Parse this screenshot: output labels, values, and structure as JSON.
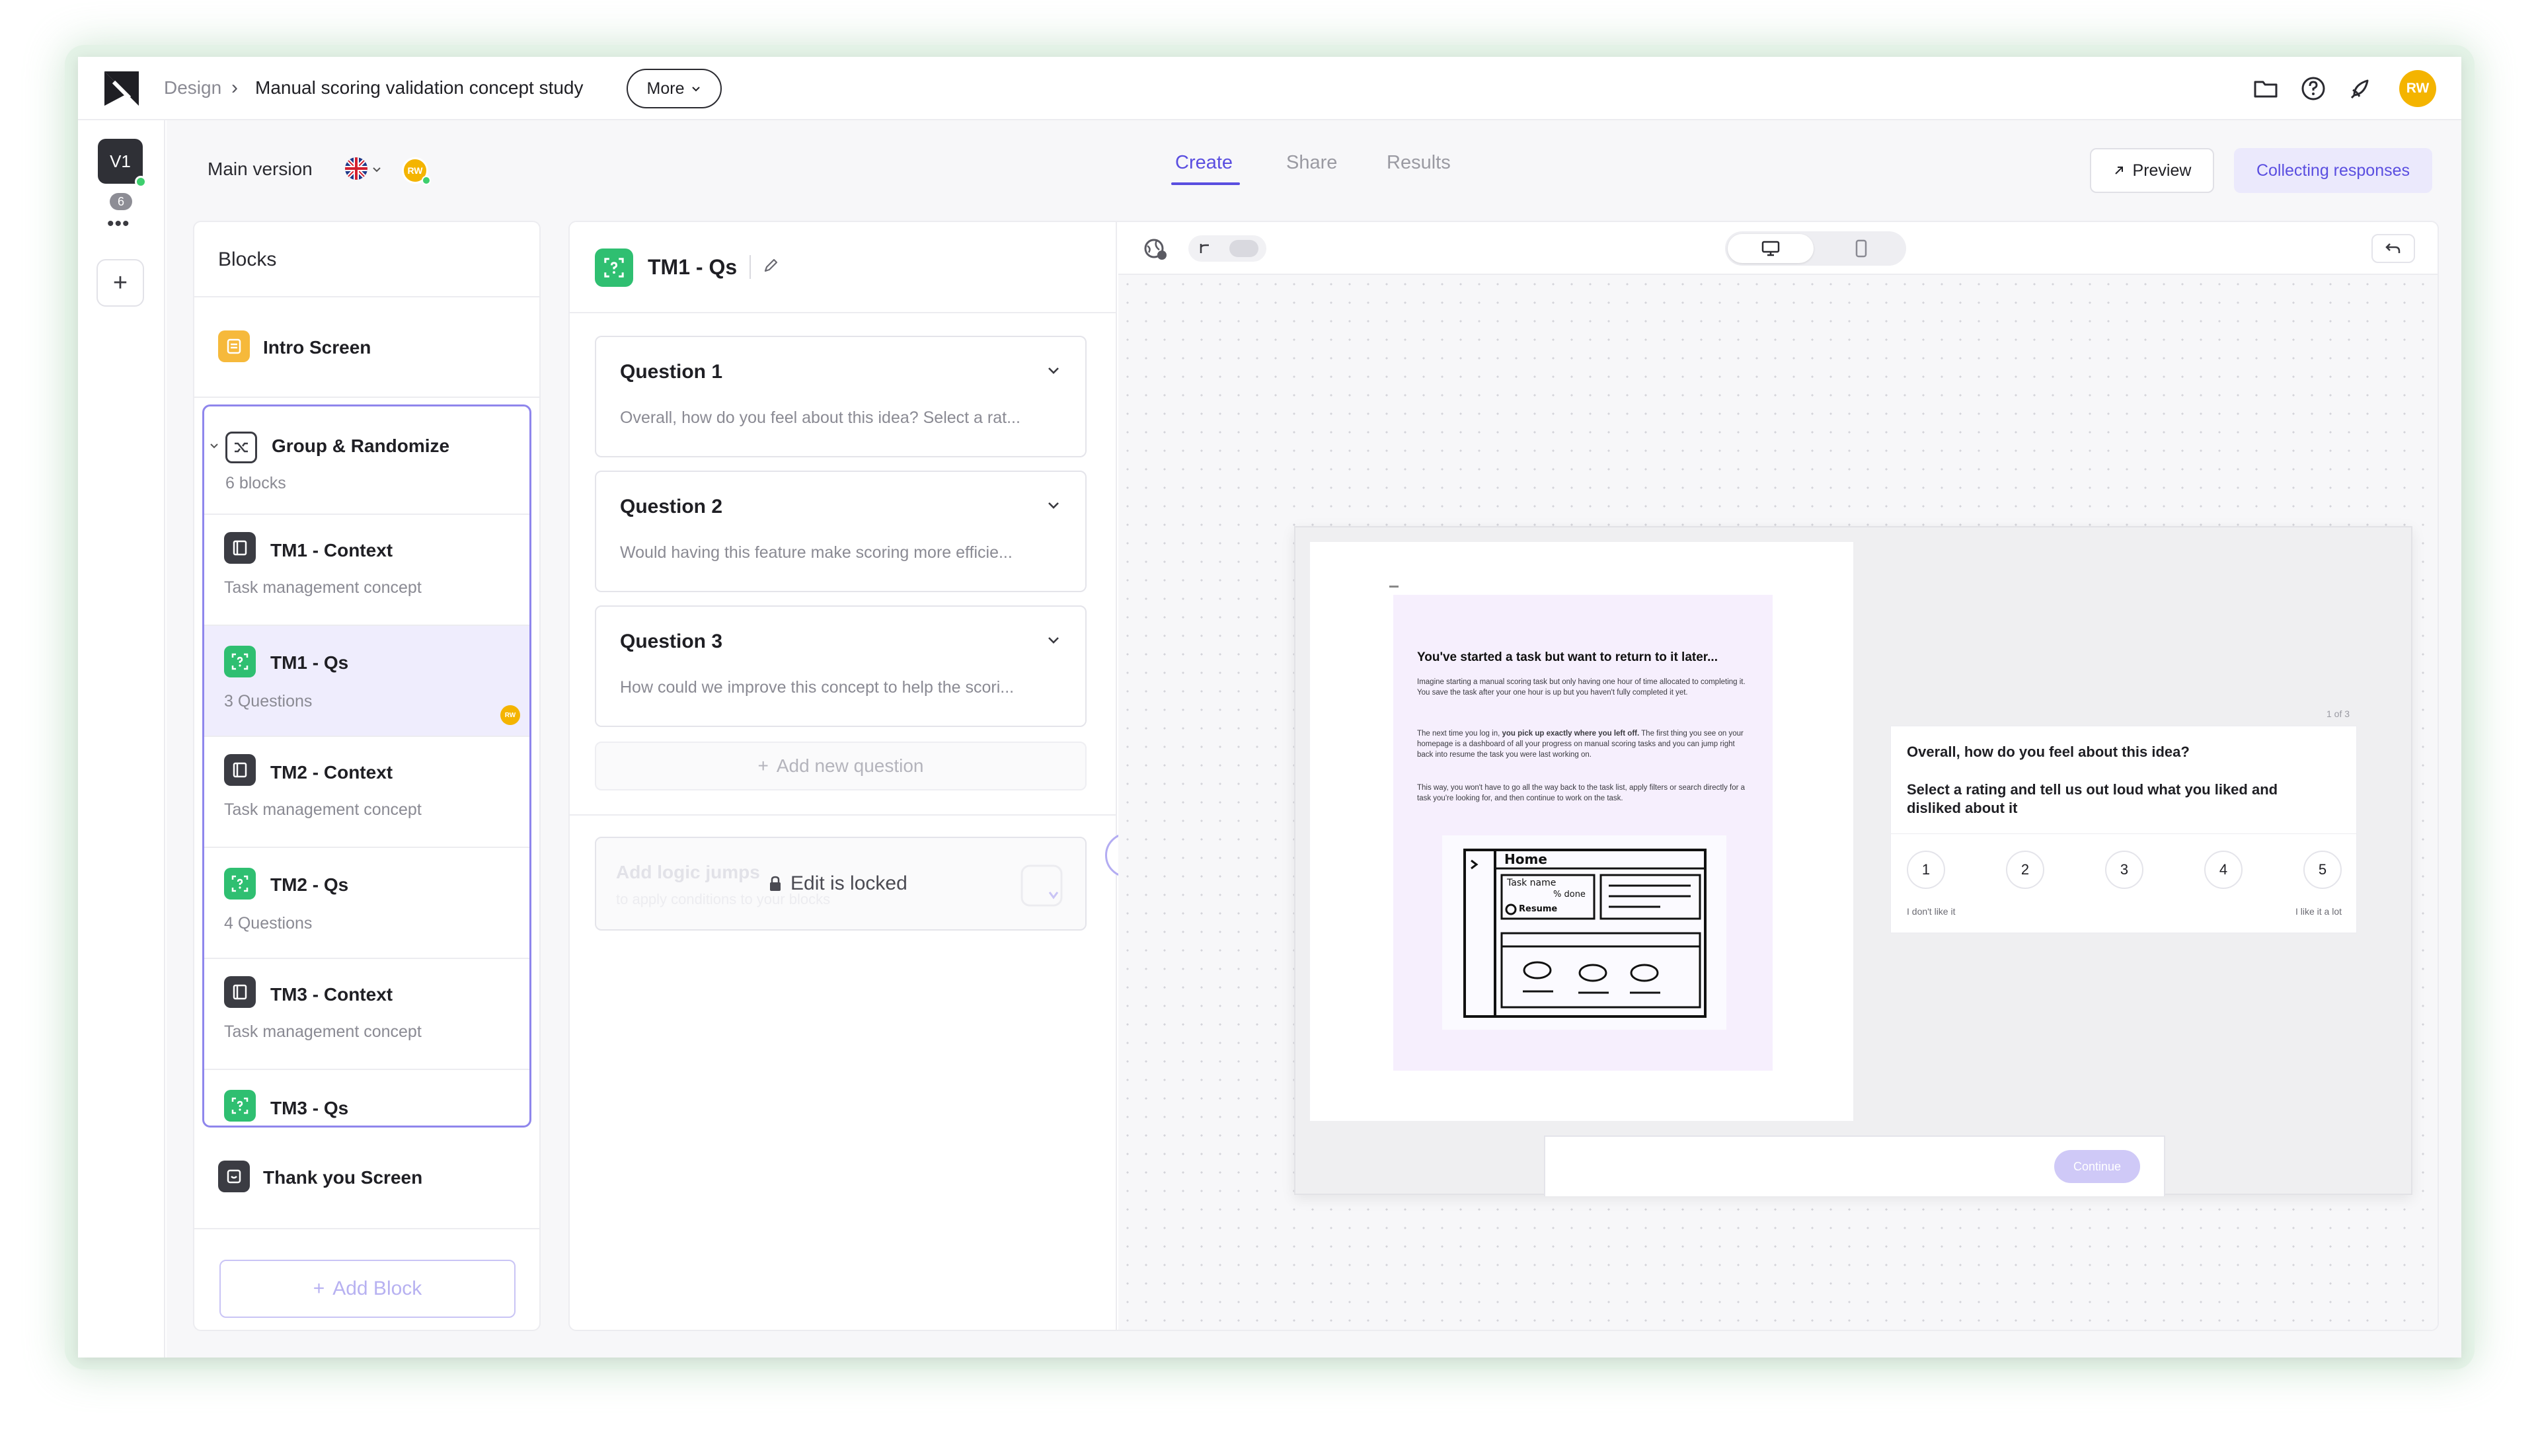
{
  "header": {
    "breadcrumb_parent": "Design",
    "breadcrumb_separator": "›",
    "study_title": "Manual scoring validation concept study",
    "more_label": "More",
    "avatar_initials": "RW"
  },
  "rail": {
    "version_label": "V1",
    "version_count": "6",
    "dots": "•••",
    "add": "+"
  },
  "subheader": {
    "version_name": "Main version",
    "collaborator_initials": "RW",
    "tabs": [
      {
        "label": "Create",
        "active": true
      },
      {
        "label": "Share",
        "active": false
      },
      {
        "label": "Results",
        "active": false
      }
    ],
    "preview_label": "Preview",
    "collecting_label": "Collecting responses"
  },
  "blocks": {
    "title": "Blocks",
    "intro": {
      "title": "Intro Screen"
    },
    "group": {
      "title": "Group & Randomize",
      "subtitle": "6 blocks"
    },
    "items": [
      {
        "title": "TM1 - Context",
        "subtitle": "Task management concept",
        "type": "context"
      },
      {
        "title": "TM1 - Qs",
        "subtitle": "3 Questions",
        "type": "questions",
        "selected": true
      },
      {
        "title": "TM2 - Context",
        "subtitle": "Task management concept",
        "type": "context"
      },
      {
        "title": "TM2 - Qs",
        "subtitle": "4 Questions",
        "type": "questions"
      },
      {
        "title": "TM3 - Context",
        "subtitle": "Task management concept",
        "type": "context"
      },
      {
        "title": "TM3 - Qs",
        "subtitle": "",
        "type": "questions"
      }
    ],
    "thankyou": {
      "title": "Thank you Screen"
    },
    "add_block_label": "Add Block",
    "selected_badge": "RW"
  },
  "editor": {
    "block_title": "TM1 - Qs",
    "questions": [
      {
        "title": "Question 1",
        "text": "Overall, how do you feel about this idea? Select a rat..."
      },
      {
        "title": "Question 2",
        "text": "Would having this feature make scoring more efficie..."
      },
      {
        "title": "Question 3",
        "text": "How could we improve this concept to help the scori..."
      }
    ],
    "add_question_label": "Add new question",
    "logic_title": "Add logic jumps",
    "logic_subtitle": "to apply conditions to your blocks",
    "locked_label": "Edit is locked"
  },
  "preview": {
    "heading": "You've started a task but want to return to it later...",
    "para1": "Imagine starting a manual scoring task but only having one hour of time allocated to completing it. You save the task after your one hour is up but you haven't fully completed it yet.",
    "para2_prefix": "The next time you log in, ",
    "para2_bold": "you pick up exactly where you left off.",
    "para2_suffix": " The first thing you see on your homepage is a dashboard of all your progress on manual scoring tasks and you can jump right back into resume the task you were last working on.",
    "para3": "This way, you won't have to go all the way back to the task list, apply filters or search directly for a task you're looking for, and then continue to work on the task.",
    "sketch_home": "Home",
    "sketch_task": "Task name",
    "sketch_done": "% done",
    "sketch_resume": "Resume",
    "counter": "1 of 3",
    "question": "Overall, how do you feel about this idea?",
    "instruction": "Select a rating and tell us out loud what you liked and disliked about it",
    "ratings": [
      "1",
      "2",
      "3",
      "4",
      "5"
    ],
    "low_label": "I don't like it",
    "high_label": "I like it a lot",
    "continue_label": "Continue"
  },
  "colors": {
    "accent": "#5a4ee0",
    "block_green": "#2fbf71",
    "block_dark": "#3b3c43",
    "block_yellow": "#f6b93b",
    "avatar": "#f4b400"
  }
}
